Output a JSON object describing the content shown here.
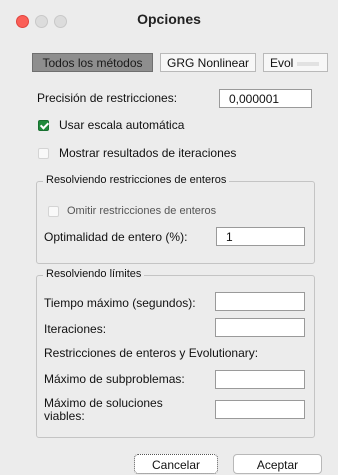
{
  "window": {
    "title": "Opciones"
  },
  "tabs": [
    {
      "label": "Todos los métodos",
      "active": true
    },
    {
      "label": "GRG Nonlinear",
      "active": false
    },
    {
      "label": "Evol",
      "active": false
    }
  ],
  "precision": {
    "label": "Precisión de restricciones:",
    "value": "0,000001"
  },
  "autoscale": {
    "label": "Usar escala automática",
    "checked": true
  },
  "show_iterations": {
    "label": "Mostrar resultados de iteraciones",
    "checked": false
  },
  "integer_group": {
    "title": "Resolviendo restricciones de enteros",
    "ignore_label": "Omitir restricciones de enteros",
    "ignore_checked": false,
    "optimality_label": "Optimalidad de entero (%):",
    "optimality_value": "1"
  },
  "limits_group": {
    "title": "Resolviendo límites",
    "max_time_label": "Tiempo máximo (segundos):",
    "max_time_value": "",
    "iterations_label": "Iteraciones:",
    "iterations_value": "",
    "subheading": "Restricciones de enteros y Evolutionary:",
    "max_subproblems_label": "Máximo de subproblemas:",
    "max_subproblems_value": "",
    "max_solutions_label_line1": "Máximo de soluciones",
    "max_solutions_label_line2": "viables:",
    "max_solutions_value": ""
  },
  "buttons": {
    "cancel": "Cancelar",
    "ok": "Aceptar"
  },
  "colors": {
    "checkbox_on": "#1f8a3b",
    "close_button": "#fb5f57",
    "active_tab": "#8e8e8e"
  }
}
